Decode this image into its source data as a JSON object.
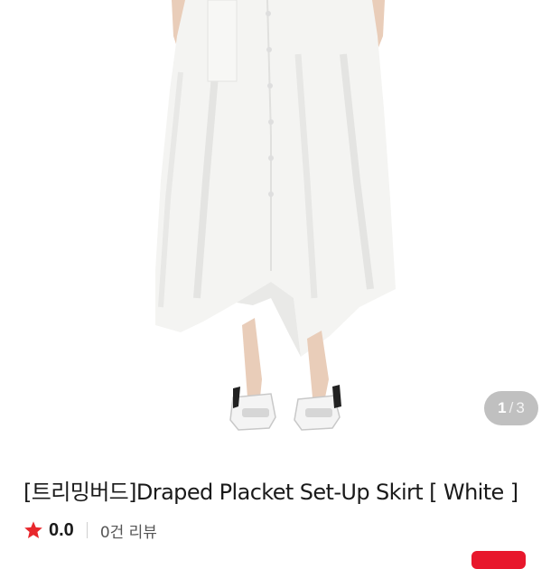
{
  "gallery": {
    "current_page": "1",
    "separator": "/",
    "total_pages": "3"
  },
  "product": {
    "title": "[트리밍버드]Draped Placket Set-Up Skirt [ White ]"
  },
  "rating": {
    "score": "0.0",
    "review_count_label": "0건 리뷰",
    "star_color": "#e8272c"
  },
  "colors": {
    "badge": "#e8172c",
    "text": "#1a1a1a"
  }
}
